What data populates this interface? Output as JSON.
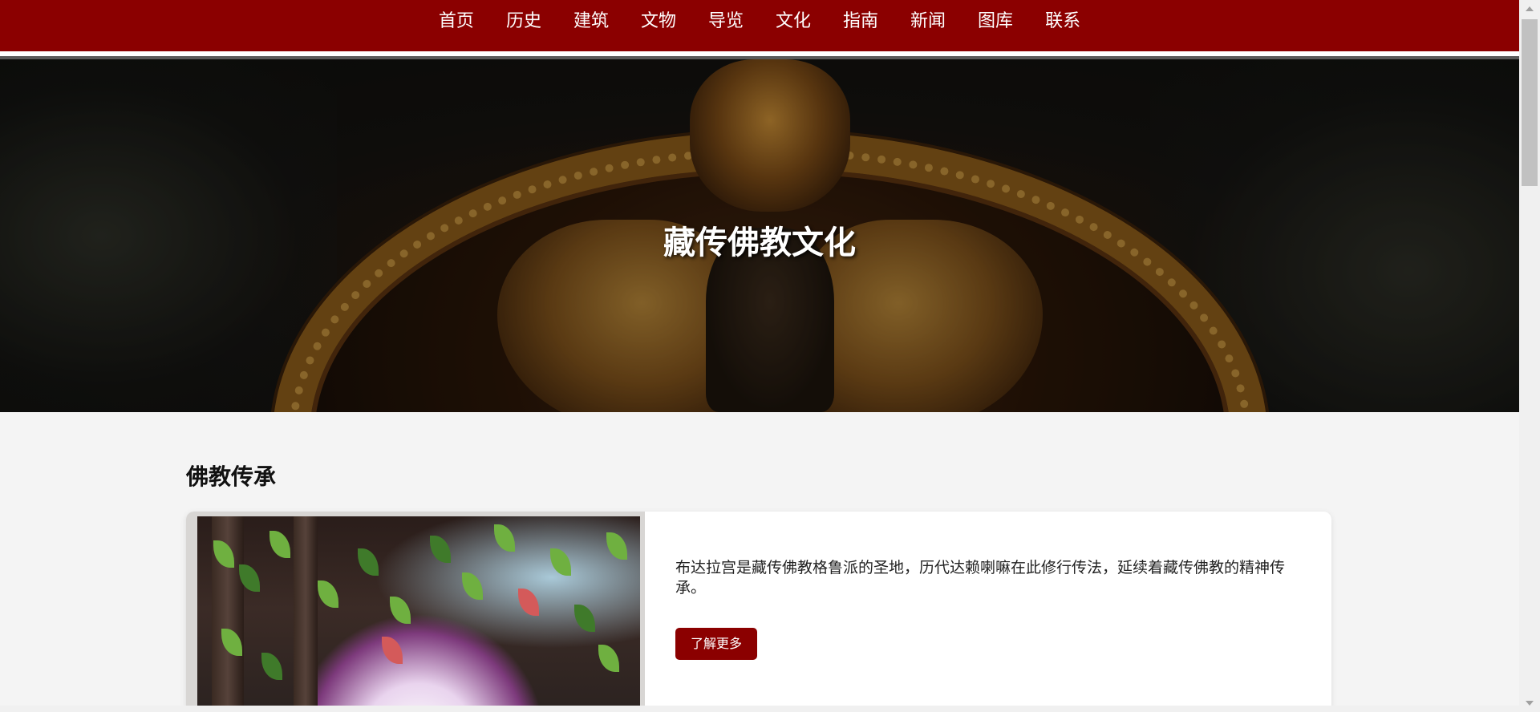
{
  "nav": {
    "items": [
      {
        "label": "首页"
      },
      {
        "label": "历史"
      },
      {
        "label": "建筑"
      },
      {
        "label": "文物"
      },
      {
        "label": "导览"
      },
      {
        "label": "文化"
      },
      {
        "label": "指南"
      },
      {
        "label": "新闻"
      },
      {
        "label": "图库"
      },
      {
        "label": "联系"
      }
    ]
  },
  "hero": {
    "title": "藏传佛教文化"
  },
  "section": {
    "title": "佛教传承",
    "card": {
      "text": "布达拉宫是藏传佛教格鲁派的圣地，历代达赖喇嘛在此修行传法，延续着藏传佛教的精神传承。",
      "button_label": "了解更多"
    }
  },
  "colors": {
    "brand": "#8b0000",
    "page_bg": "#f4f4f4",
    "card_bg": "#ffffff"
  }
}
